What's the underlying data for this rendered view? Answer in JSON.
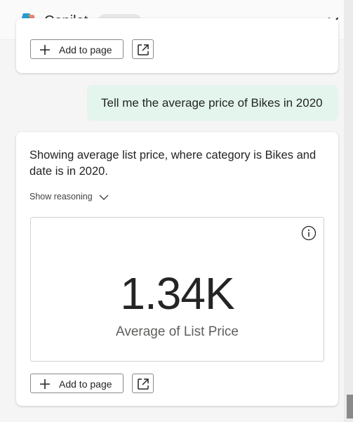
{
  "header": {
    "title": "Copilot",
    "badge": "Preview",
    "logo_icon": "copilot-logo",
    "close_icon": "close-icon"
  },
  "top_card": {
    "add_label": "Add to page",
    "expand_icon": "expand-icon"
  },
  "user_message": {
    "text": "Tell me the average price of Bikes in 2020"
  },
  "response": {
    "text": "Showing average list price, where category is Bikes and date is in 2020.",
    "show_reasoning": "Show reasoning",
    "kpi": {
      "value": "1.34K",
      "label": "Average of List Price"
    },
    "add_label": "Add to page",
    "expand_icon": "expand-icon",
    "info_icon": "info-icon"
  },
  "colors": {
    "user_bubble": "#e3f5ec",
    "background": "#f5f5f5",
    "card": "#ffffff"
  }
}
